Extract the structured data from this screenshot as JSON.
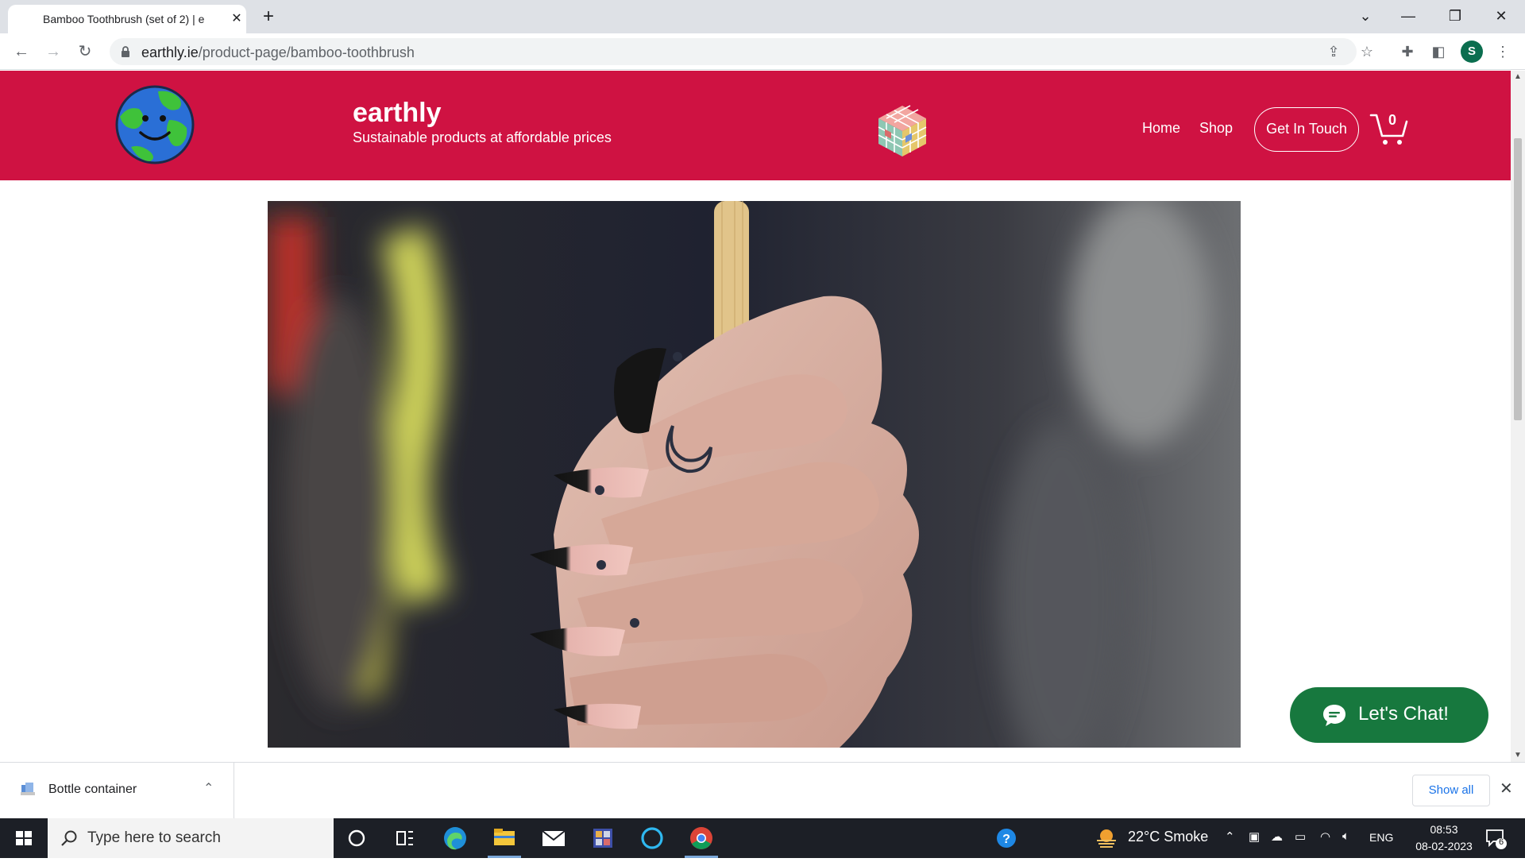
{
  "browser": {
    "tab_title": "Bamboo Toothbrush (set of 2) | e",
    "tab_close": "✕",
    "new_tab": "+",
    "url_domain": "earthly.ie",
    "url_path": "/product-page/bamboo-toothbrush",
    "profile_initial": "S",
    "window_controls": {
      "minimize": "—",
      "restore": "❐",
      "close": "✕",
      "tab_search": "⌄"
    }
  },
  "site": {
    "brand": "earthly",
    "tagline": "Sustainable products at affordable prices",
    "nav": {
      "home": "Home",
      "shop": "Shop",
      "contact": "Get In Touch"
    },
    "cart_count": "0",
    "colors": {
      "header": "#cf1242",
      "chat": "#17783e"
    }
  },
  "chat": {
    "label": "Let's Chat!"
  },
  "downloads": {
    "file_name": "Bottle container",
    "show_all": "Show all",
    "close": "✕"
  },
  "taskbar": {
    "search_placeholder": "Type here to search",
    "weather": "22°C  Smoke",
    "language": "ENG",
    "time": "08:53",
    "date": "08-02-2023",
    "notifications": "6"
  }
}
